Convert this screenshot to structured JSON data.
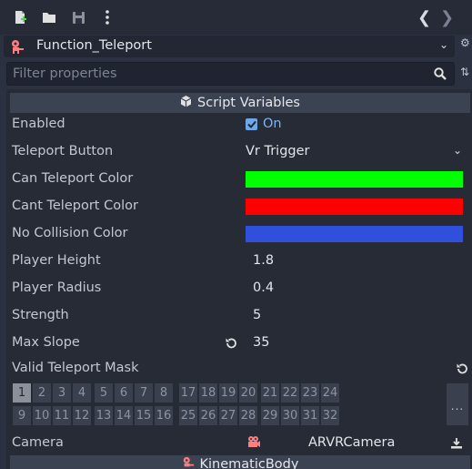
{
  "header": {
    "node_name": "Function_Teleport",
    "filter_placeholder": "Filter properties"
  },
  "section": {
    "title": "Script Variables",
    "footer_title": "KinematicBody"
  },
  "properties": {
    "enabled": {
      "label": "Enabled",
      "value": "On",
      "checked": true
    },
    "teleport_button": {
      "label": "Teleport Button",
      "value": "Vr Trigger"
    },
    "can_teleport_color": {
      "label": "Can Teleport Color",
      "color": "#00ff00"
    },
    "cant_teleport_color": {
      "label": "Cant Teleport Color",
      "color": "#ff0000"
    },
    "no_collision_color": {
      "label": "No Collision Color",
      "color": "#2f4fdc"
    },
    "player_height": {
      "label": "Player Height",
      "value": "1.8"
    },
    "player_radius": {
      "label": "Player Radius",
      "value": "0.4"
    },
    "strength": {
      "label": "Strength",
      "value": "5"
    },
    "max_slope": {
      "label": "Max Slope",
      "value": "35"
    },
    "valid_teleport_mask": {
      "label": "Valid Teleport Mask",
      "layers": [
        "1",
        "2",
        "3",
        "4",
        "5",
        "6",
        "7",
        "8",
        "9",
        "10",
        "11",
        "12",
        "13",
        "14",
        "15",
        "16",
        "17",
        "18",
        "19",
        "20",
        "21",
        "22",
        "23",
        "24",
        "25",
        "26",
        "27",
        "28",
        "29",
        "30",
        "31",
        "32"
      ],
      "active_layers": [
        "1"
      ],
      "more_label": "..."
    },
    "camera": {
      "label": "Camera",
      "value": "ARVRCamera"
    }
  },
  "colors": {
    "panel": "#2b3140",
    "section_header": "#3b4252",
    "accent": "#7fb3ef"
  },
  "icons": [
    "new-script-icon",
    "open-folder-icon",
    "save-icon",
    "kebab-menu-icon",
    "history-back-icon",
    "history-forward-icon",
    "node-robot-icon",
    "dropdown-chevron-icon",
    "search-icon",
    "box-icon",
    "revert-icon",
    "camera-icon",
    "node-picker-icon"
  ]
}
